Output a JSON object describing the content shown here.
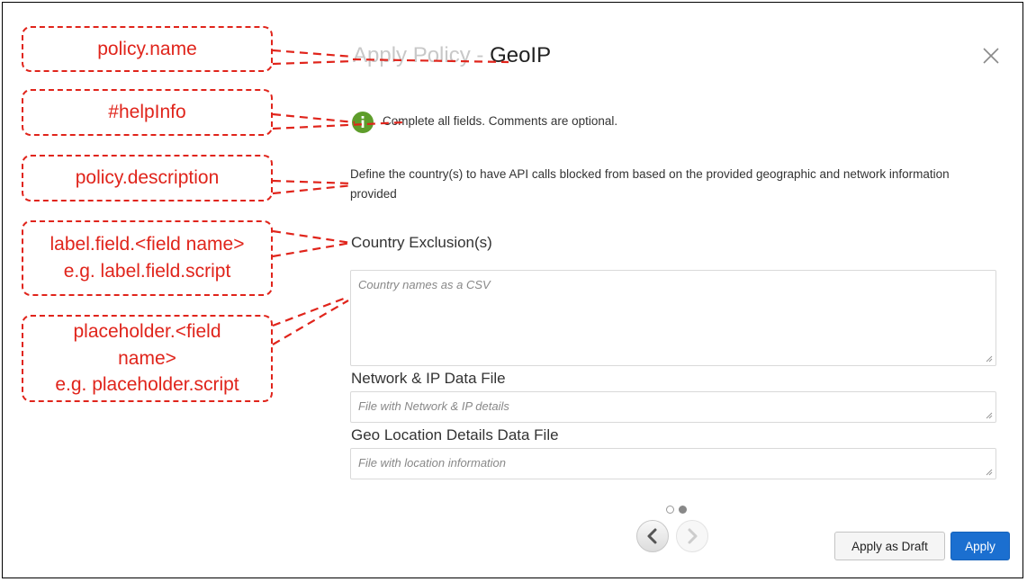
{
  "dialog": {
    "title_prefix": "Apply Policy - ",
    "policy_name": "GeoIP",
    "help_text": "Complete all fields. Comments are optional.",
    "description": "Define the country(s) to have API calls blocked from based on the provided geographic and network information provided",
    "close_icon": "close-icon",
    "help_icon": "info-icon"
  },
  "fields": [
    {
      "label": "Country Exclusion(s)",
      "placeholder": "Country names as a CSV",
      "value": ""
    },
    {
      "label": "Network & IP Data File",
      "placeholder": "File with Network & IP details",
      "value": ""
    },
    {
      "label": "Geo Location Details Data File",
      "placeholder": "File with location information",
      "value": ""
    }
  ],
  "pagination": {
    "current_page": 2,
    "total_pages": 2
  },
  "buttons": {
    "draft_label": "Apply as Draft",
    "apply_label": "Apply"
  },
  "annotations": [
    {
      "text": "policy.name"
    },
    {
      "text": "#helpInfo"
    },
    {
      "text": "policy.description"
    },
    {
      "text": "label.field.<field name>\ne.g. label.field.script"
    },
    {
      "text": "placeholder.<field\nname>\ne.g. placeholder.script"
    }
  ],
  "colors": {
    "annotation": "#e0241b",
    "primary_button": "#1b6fd0",
    "help_icon": "#5e9d2b",
    "title_muted": "#c8c8c8"
  }
}
